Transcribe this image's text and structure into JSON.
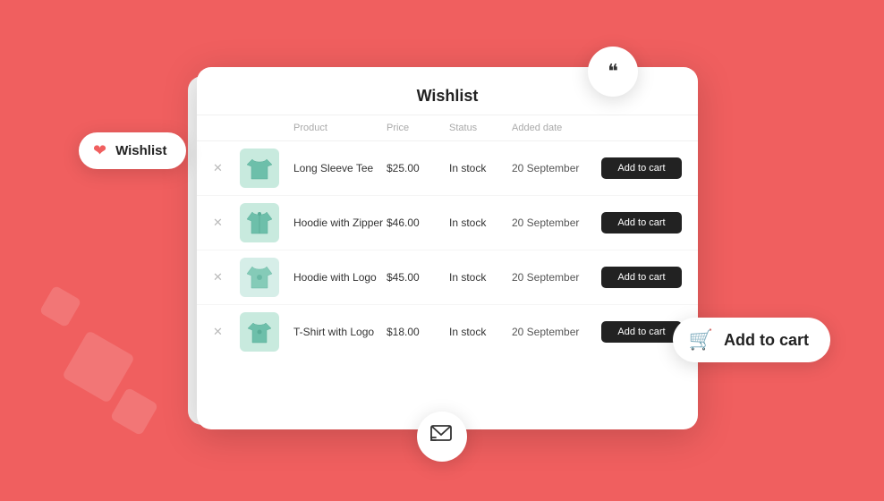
{
  "background_color": "#f05f5f",
  "page_title": "Wishlist",
  "float_wishlist": {
    "label": "Wishlist",
    "icon": "❤"
  },
  "float_addtocart": {
    "label": "Add to cart",
    "icon": "🛒"
  },
  "table": {
    "headers": [
      "",
      "",
      "Product",
      "Price",
      "Status",
      "Added date",
      ""
    ],
    "rows": [
      {
        "id": 1,
        "product_name": "Long Sleeve Tee",
        "price": "$25.00",
        "status": "In stock",
        "added_date": "20 September",
        "btn_label": "Add to cart",
        "img_type": "tee"
      },
      {
        "id": 2,
        "product_name": "Hoodie with Zipper",
        "price": "$46.00",
        "status": "In stock",
        "added_date": "20 September",
        "btn_label": "Add to cart",
        "img_type": "hoodie1"
      },
      {
        "id": 3,
        "product_name": "Hoodie with Logo",
        "price": "$45.00",
        "status": "In stock",
        "added_date": "20 September",
        "btn_label": "Add to cart",
        "img_type": "hoodie2"
      },
      {
        "id": 4,
        "product_name": "T-Shirt with Logo",
        "price": "$18.00",
        "status": "In stock",
        "added_date": "20 September",
        "btn_label": "Add to cart",
        "img_type": "tshirt"
      }
    ]
  },
  "decorative": {
    "quote_icon": "❞",
    "email_icon": "✉"
  }
}
